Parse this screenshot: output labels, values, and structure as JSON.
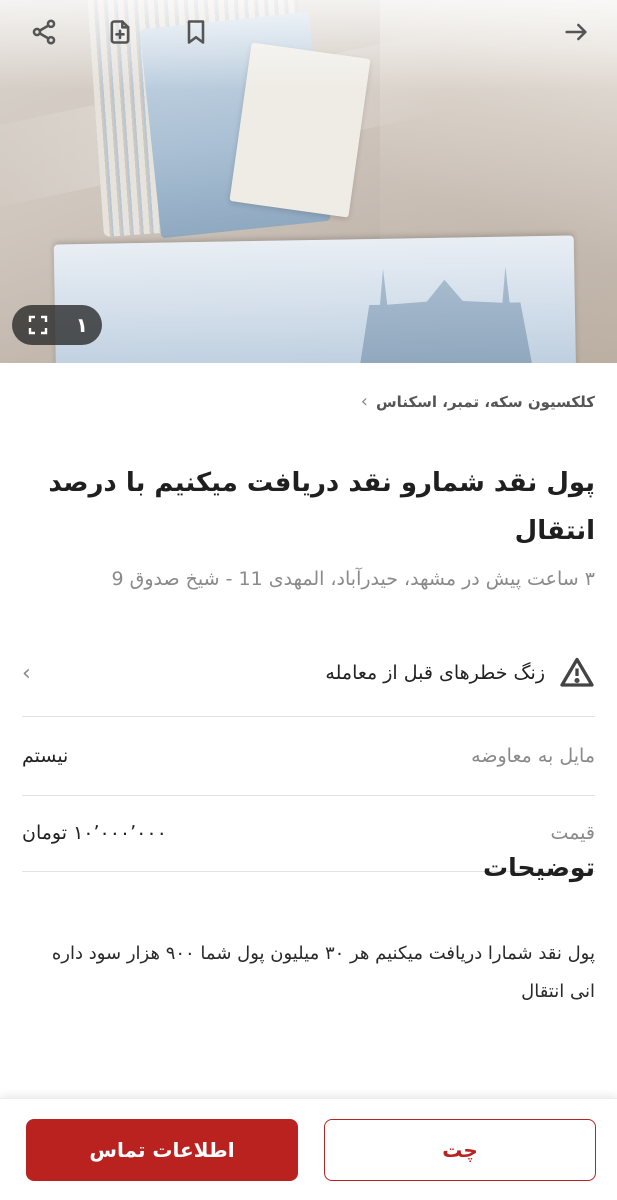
{
  "gallery": {
    "count": "۱"
  },
  "breadcrumb": {
    "category": "کلکسیون سکه، تمبر، اسکناس"
  },
  "post": {
    "title": "پول نقد شمارو نقد دریافت میکنیم با درصد انتقال",
    "meta": "۳ ساعت پیش در مشهد، حیدرآباد، المهدی 11 - شیخ صدوق 9"
  },
  "alarm": {
    "label": "زنگ خطرهای قبل از معامله"
  },
  "attributes": [
    {
      "key": "مایل به معاوضه",
      "value": "نیستم"
    },
    {
      "key": "قیمت",
      "value": "۱۰٬۰۰۰٬۰۰۰ تومان"
    }
  ],
  "description": {
    "title": "توضیحات",
    "body": "پول نقد شمارا دریافت میکنیم هر ۳۰ میلیون پول شما ۹۰۰ هزار سود داره انی انتقال"
  },
  "actions": {
    "contact": "اطلاعات تماس",
    "chat": "چت"
  }
}
